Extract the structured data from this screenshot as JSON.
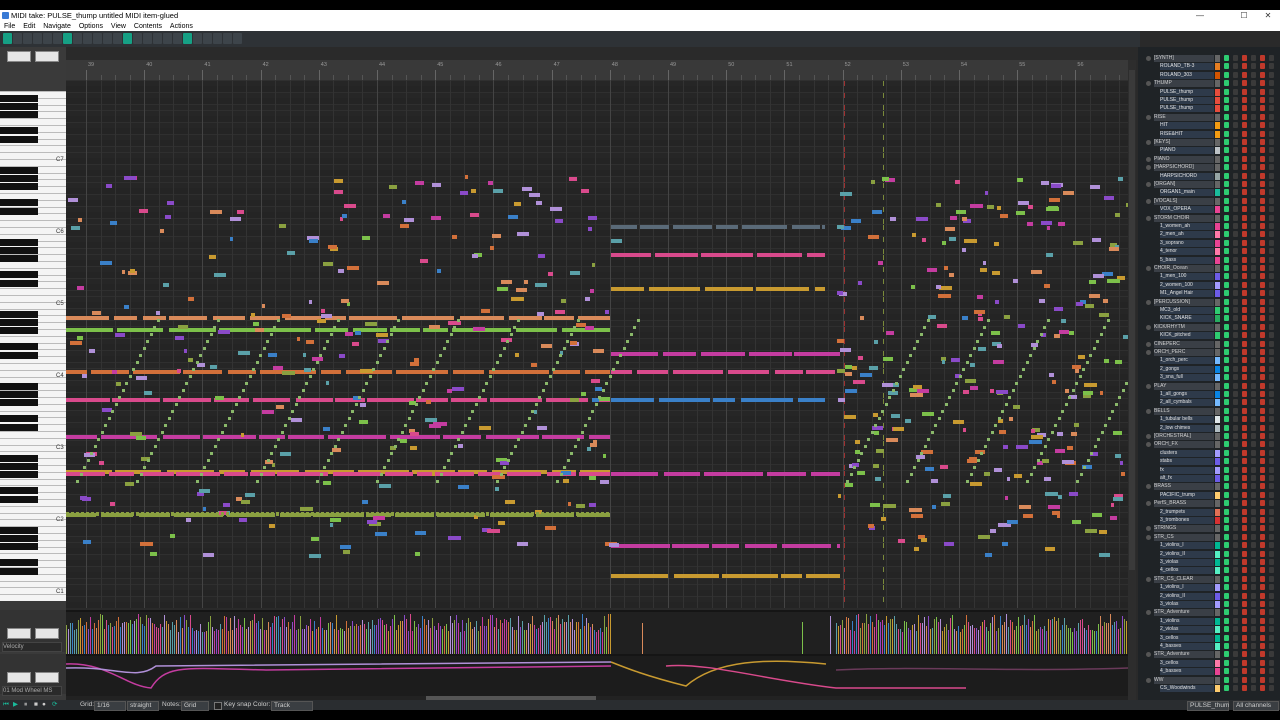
{
  "window": {
    "title": "MIDI take: PULSE_thump untitled MIDI item-glued",
    "minimize": "—",
    "maximize": "☐",
    "close": "✕"
  },
  "menu": [
    "File",
    "Edit",
    "Navigate",
    "Options",
    "View",
    "Contents",
    "Actions"
  ],
  "keyboard": {
    "octaves": [
      "C7",
      "C6",
      "C5",
      "C4",
      "C3",
      "C2",
      "C1"
    ]
  },
  "ruler": {
    "bar_labels": [
      "39",
      "40",
      "41",
      "42",
      "43",
      "44",
      "45",
      "46",
      "47",
      "48",
      "49",
      "50",
      "51",
      "52",
      "53",
      "54",
      "55",
      "56"
    ]
  },
  "lanes": {
    "velocity_label": "Velocity",
    "cc_label": "01 Mod Wheel MS"
  },
  "bottom": {
    "grid_label": "Grid:",
    "grid_value": "1/16",
    "swing_value": "straight",
    "notes_label": "Notes:",
    "notes_value": "Grid",
    "keysnap_label": "Key snap",
    "color_label": "Color:",
    "color_value": "Track",
    "take_value": "PULSE_thum",
    "channel_value": "All channels"
  },
  "tracks": [
    {
      "name": "[SYNTH]",
      "folder": true,
      "color": "#666666"
    },
    {
      "name": "ROLAND_TB-3",
      "folder": false,
      "color": "#e67e22"
    },
    {
      "name": "ROLAND_303",
      "folder": false,
      "color": "#d35400"
    },
    {
      "name": "THUMP",
      "folder": true,
      "color": "#666666"
    },
    {
      "name": "PULSE_thump",
      "folder": false,
      "color": "#e74c3c"
    },
    {
      "name": "PULSE_thump",
      "folder": false,
      "color": "#e74c3c"
    },
    {
      "name": "PULSE_thump",
      "folder": false,
      "color": "#e74c3c"
    },
    {
      "name": "RISE",
      "folder": true,
      "color": "#666666"
    },
    {
      "name": "HIT",
      "folder": false,
      "color": "#f39c12"
    },
    {
      "name": "RISE&HIT",
      "folder": false,
      "color": "#f39c12"
    },
    {
      "name": "[KEYS]",
      "folder": true,
      "color": "#666666"
    },
    {
      "name": "PIANO",
      "folder": false,
      "color": "#bdc3c7"
    },
    {
      "name": "PIANO",
      "folder": true,
      "color": "#666666"
    },
    {
      "name": "[HARPSICHORD]",
      "folder": true,
      "color": "#666666"
    },
    {
      "name": "HARPSICHORD",
      "folder": false,
      "color": "#95a5a6"
    },
    {
      "name": "[ORGAN]",
      "folder": true,
      "color": "#666666"
    },
    {
      "name": "ORGAN1_main",
      "folder": false,
      "color": "#1abc9c"
    },
    {
      "name": "[VOCALS]",
      "folder": true,
      "color": "#666666"
    },
    {
      "name": "VOX_OPERA",
      "folder": false,
      "color": "#e84393"
    },
    {
      "name": "STORM CHOIR",
      "folder": true,
      "color": "#666666"
    },
    {
      "name": "1_women_ah",
      "folder": false,
      "color": "#e84393"
    },
    {
      "name": "2_men_ah",
      "folder": false,
      "color": "#fd79a8"
    },
    {
      "name": "3_soprano",
      "folder": false,
      "color": "#e84393"
    },
    {
      "name": "4_tenor",
      "folder": false,
      "color": "#fd79a8"
    },
    {
      "name": "5_bass",
      "folder": false,
      "color": "#e84393"
    },
    {
      "name": "CHOIR_Ocean",
      "folder": true,
      "color": "#666666"
    },
    {
      "name": "1_men_100",
      "folder": false,
      "color": "#6c5ce7"
    },
    {
      "name": "2_women_100",
      "folder": false,
      "color": "#a29bfe"
    },
    {
      "name": "M1_Angel Hair",
      "folder": false,
      "color": "#6c5ce7"
    },
    {
      "name": "[PERCUSSION]",
      "folder": true,
      "color": "#666666"
    },
    {
      "name": "MC3_old",
      "folder": false,
      "color": "#2ecc71"
    },
    {
      "name": "KICK_SNARE",
      "folder": false,
      "color": "#27ae60"
    },
    {
      "name": "KICK/RHYTM",
      "folder": true,
      "color": "#666666"
    },
    {
      "name": "KICK_pitched",
      "folder": false,
      "color": "#2ecc71"
    },
    {
      "name": "CINEPERC",
      "folder": true,
      "color": "#666666"
    },
    {
      "name": "ORCH_PERC",
      "folder": true,
      "color": "#666666"
    },
    {
      "name": "1_orch_perc",
      "folder": false,
      "color": "#74b9ff"
    },
    {
      "name": "2_gongs",
      "folder": false,
      "color": "#0984e3"
    },
    {
      "name": "3_sna_full",
      "folder": false,
      "color": "#74b9ff"
    },
    {
      "name": "PLAY",
      "folder": true,
      "color": "#666666"
    },
    {
      "name": "1_all_gongs",
      "folder": false,
      "color": "#0984e3"
    },
    {
      "name": "2_all_cymbals",
      "folder": false,
      "color": "#74b9ff"
    },
    {
      "name": "BELLS",
      "folder": true,
      "color": "#666666"
    },
    {
      "name": "1_tubular bells",
      "folder": false,
      "color": "#dfe6e9"
    },
    {
      "name": "2_low chimes",
      "folder": false,
      "color": "#b2bec3"
    },
    {
      "name": "[ORCHESTRAL]",
      "folder": true,
      "color": "#666666"
    },
    {
      "name": "ORCH_FX",
      "folder": true,
      "color": "#666666"
    },
    {
      "name": "clusters",
      "folder": false,
      "color": "#a29bfe"
    },
    {
      "name": "stabs",
      "folder": false,
      "color": "#6c5ce7"
    },
    {
      "name": "fx",
      "folder": false,
      "color": "#a29bfe"
    },
    {
      "name": "alt_fx",
      "folder": false,
      "color": "#6c5ce7"
    },
    {
      "name": "BRASS",
      "folder": true,
      "color": "#666666"
    },
    {
      "name": "PACIFIC_trump",
      "folder": false,
      "color": "#fdcb6e"
    },
    {
      "name": "PerfS_BRASS",
      "folder": true,
      "color": "#666666"
    },
    {
      "name": "2_trumpets",
      "folder": false,
      "color": "#e17055"
    },
    {
      "name": "3_trombones",
      "folder": false,
      "color": "#d63031"
    },
    {
      "name": "STRINGS",
      "folder": true,
      "color": "#666666"
    },
    {
      "name": "STR_CS",
      "folder": true,
      "color": "#666666"
    },
    {
      "name": "1_violins_I",
      "folder": false,
      "color": "#00b894"
    },
    {
      "name": "2_violins_II",
      "folder": false,
      "color": "#55efc4"
    },
    {
      "name": "3_violas",
      "folder": false,
      "color": "#00b894"
    },
    {
      "name": "4_cellos",
      "folder": false,
      "color": "#55efc4"
    },
    {
      "name": "STR_CS_CLEAR",
      "folder": true,
      "color": "#666666"
    },
    {
      "name": "1_violins_I",
      "folder": false,
      "color": "#a29bfe"
    },
    {
      "name": "2_violins_II",
      "folder": false,
      "color": "#6c5ce7"
    },
    {
      "name": "3_violas",
      "folder": false,
      "color": "#a29bfe"
    },
    {
      "name": "STR_Adventure",
      "folder": true,
      "color": "#666666"
    },
    {
      "name": "1_violins",
      "folder": false,
      "color": "#00b894"
    },
    {
      "name": "2_violas",
      "folder": false,
      "color": "#55efc4"
    },
    {
      "name": "3_cellos",
      "folder": false,
      "color": "#00b894"
    },
    {
      "name": "4_basses",
      "folder": false,
      "color": "#55efc4"
    },
    {
      "name": "STR_Adventure",
      "folder": true,
      "color": "#666666"
    },
    {
      "name": "3_cellos",
      "folder": false,
      "color": "#fd79a8"
    },
    {
      "name": "4_basses",
      "folder": false,
      "color": "#e84393"
    },
    {
      "name": "WW",
      "folder": true,
      "color": "#666666"
    },
    {
      "name": "CS_Woodwinds",
      "folder": false,
      "color": "#fdcb6e"
    }
  ],
  "colors": {
    "orange": "#d2703a",
    "salmon": "#d98a5a",
    "pink": "#d94a8c",
    "magenta": "#c43ca0",
    "green": "#7cc04a",
    "olive": "#8aa040",
    "gold": "#c89a30",
    "teal": "#5aa0a8",
    "blue": "#3a80c8",
    "purple": "#8a4ac8",
    "lavender": "#b090d8",
    "grey": "#5a6a78"
  }
}
